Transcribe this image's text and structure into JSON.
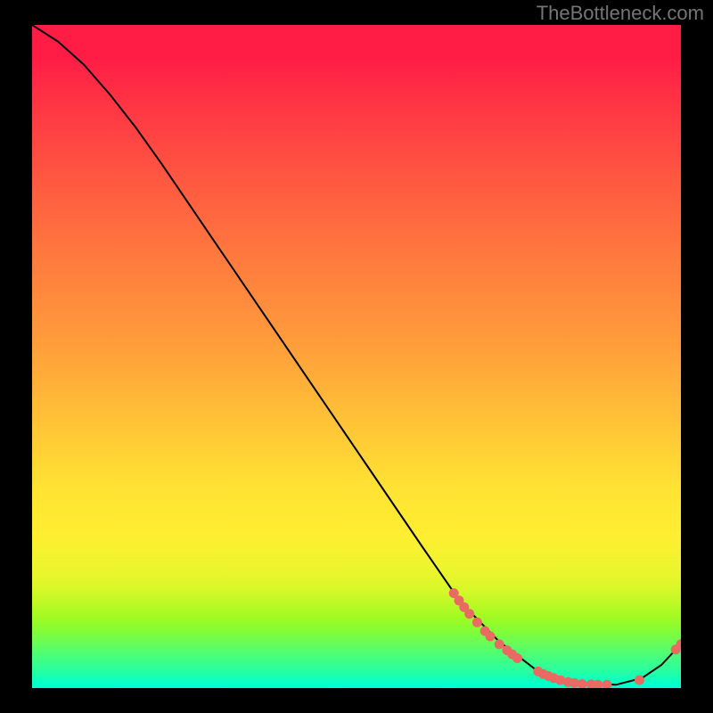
{
  "watermark": "TheBottleneck.com",
  "chart_data": {
    "type": "line",
    "title": "",
    "xlabel": "",
    "ylabel": "",
    "xlim": [
      0,
      100
    ],
    "ylim": [
      0,
      100
    ],
    "curve_xy": [
      [
        0,
        100
      ],
      [
        4,
        97.5
      ],
      [
        8,
        94
      ],
      [
        12,
        89.5
      ],
      [
        16,
        84.5
      ],
      [
        20,
        79
      ],
      [
        28,
        67.5
      ],
      [
        36,
        56
      ],
      [
        44,
        44.5
      ],
      [
        52,
        33
      ],
      [
        60,
        21.5
      ],
      [
        66,
        13
      ],
      [
        72,
        7
      ],
      [
        78,
        2.5
      ],
      [
        84,
        0.7
      ],
      [
        90,
        0.5
      ],
      [
        94,
        1.5
      ],
      [
        97,
        3.5
      ],
      [
        99.2,
        5.8
      ],
      [
        100,
        6.6
      ]
    ],
    "series": [
      {
        "name": "markers-on-curve",
        "points": [
          [
            65,
            14.3
          ],
          [
            65.8,
            13.2
          ],
          [
            66.6,
            12.2
          ],
          [
            67.4,
            11.2
          ],
          [
            68.6,
            9.9
          ],
          [
            69.8,
            8.6
          ],
          [
            70.6,
            7.8
          ],
          [
            72.0,
            6.6
          ],
          [
            73.2,
            5.7
          ],
          [
            74.0,
            5.1
          ],
          [
            74.8,
            4.5
          ],
          [
            78.0,
            2.5
          ],
          [
            78.8,
            2.1
          ],
          [
            79.6,
            1.8
          ],
          [
            80.4,
            1.5
          ],
          [
            81.4,
            1.2
          ],
          [
            82.6,
            0.9
          ],
          [
            83.6,
            0.75
          ],
          [
            84.8,
            0.6
          ],
          [
            86.2,
            0.55
          ],
          [
            87.2,
            0.5
          ],
          [
            88.6,
            0.5
          ],
          [
            93.6,
            1.2
          ],
          [
            99.2,
            5.8
          ],
          [
            100.0,
            6.6
          ]
        ]
      }
    ]
  }
}
